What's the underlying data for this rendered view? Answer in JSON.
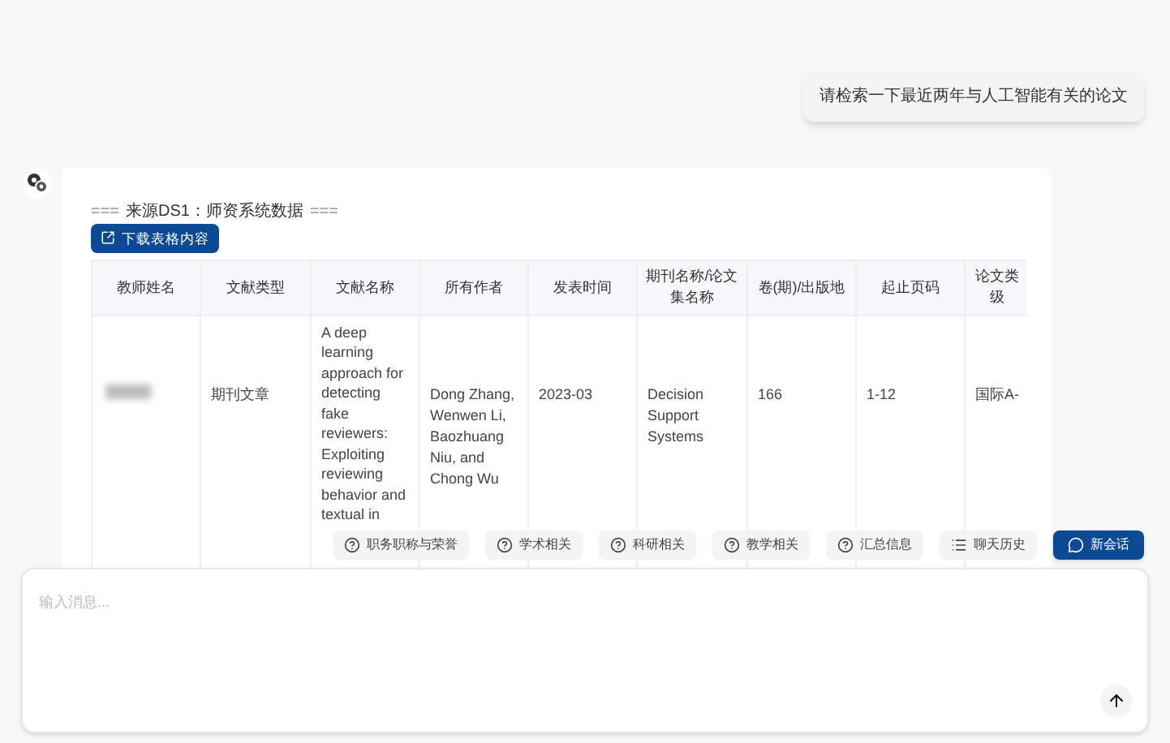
{
  "user_message": "请检索一下最近两年与人工智能有关的论文",
  "response": {
    "source_heading": {
      "marker_left": "===",
      "label": "来源DS1：师资系统数据",
      "marker_right": "==="
    },
    "download_button": "下载表格内容",
    "table": {
      "columns": [
        "教师姓名",
        "文献类型",
        "文献名称",
        "所有作者",
        "发表时间",
        "期刊名称/论文集名称",
        "卷(期)/出版地",
        "起止页码",
        "论文类级"
      ],
      "rows": [
        {
          "cells": [
            {
              "kind": "redacted"
            },
            {
              "kind": "text",
              "text": "期刊文章"
            },
            {
              "kind": "text",
              "text": "A deep learning approach for detecting fake reviewers: Exploiting reviewing behavior and textual in"
            },
            {
              "kind": "text",
              "text": "Dong Zhang, Wenwen Li, Baozhuang Niu, and Chong Wu"
            },
            {
              "kind": "text",
              "text": "2023-03"
            },
            {
              "kind": "text",
              "text": "Decision Support Systems"
            },
            {
              "kind": "text",
              "text": "166"
            },
            {
              "kind": "text",
              "text": "1-12"
            },
            {
              "kind": "text",
              "text": "国际A-"
            }
          ]
        }
      ]
    }
  },
  "quick_actions": [
    {
      "label": "职务职称与荣誉",
      "kind": "question"
    },
    {
      "label": "学术相关",
      "kind": "question"
    },
    {
      "label": "科研相关",
      "kind": "question"
    },
    {
      "label": "教学相关",
      "kind": "question"
    },
    {
      "label": "汇总信息",
      "kind": "question"
    },
    {
      "label": "聊天历史",
      "kind": "history"
    }
  ],
  "new_chat_button": "新会话",
  "input": {
    "placeholder": "输入消息..."
  }
}
